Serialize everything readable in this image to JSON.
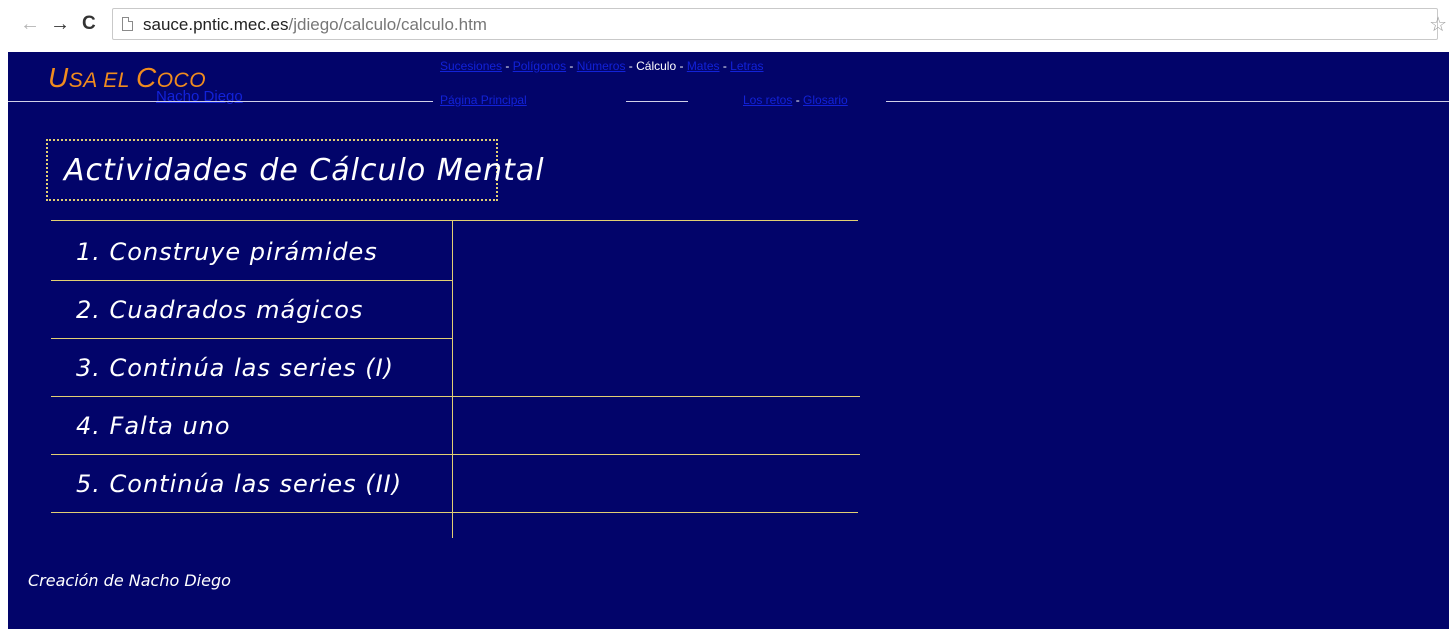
{
  "browser": {
    "back_icon": "←",
    "forward_icon": "→",
    "reload_icon": "C",
    "url_host": "sauce.pntic.mec.es",
    "url_path": "/jdiego/calculo/calculo.htm",
    "star_icon": "☆"
  },
  "header": {
    "brand_first": "U",
    "brand_rest1": "SA EL ",
    "brand_mid": "C",
    "brand_rest2": "OCO",
    "author_link": "Nacho Diego"
  },
  "topnav": {
    "row1": [
      {
        "label": "Sucesiones",
        "link": true
      },
      {
        "label": " - ",
        "link": false
      },
      {
        "label": "Polígonos",
        "link": true
      },
      {
        "label": " - ",
        "link": false
      },
      {
        "label": "Números",
        "link": true
      },
      {
        "label": " - Cálculo - ",
        "link": false,
        "current": true
      },
      {
        "label": "Mates",
        "link": true
      },
      {
        "label": " - ",
        "link": false
      },
      {
        "label": "Letras",
        "link": true
      }
    ],
    "row2_left": "Página Principal",
    "row2_right": [
      {
        "label": "Los retos",
        "link": true
      },
      {
        "label": " - ",
        "link": false
      },
      {
        "label": "Glosario",
        "link": true
      }
    ]
  },
  "main": {
    "title": "Actividades de Cálculo Mental",
    "activities": [
      "1. Construye pirámides",
      "2. Cuadrados mágicos",
      "3. Continúa las series (I)",
      "4. Falta uno",
      "5. Continúa las series (II)"
    ]
  },
  "footer": {
    "text": "Creación de Nacho Diego"
  },
  "colors": {
    "background": "#02046a",
    "brand": "#f08c1e",
    "link": "#1222d8",
    "rule": "#e2cf73"
  }
}
